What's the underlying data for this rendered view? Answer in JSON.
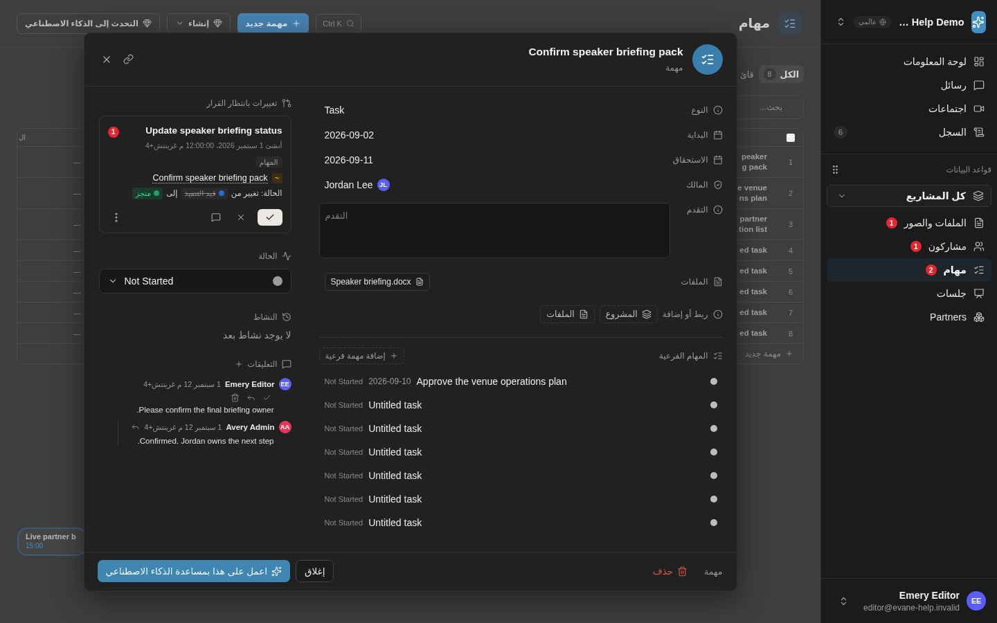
{
  "sidebar": {
    "workspace": {
      "name": "Help Demo …",
      "scope": "عالمي"
    },
    "nav": [
      {
        "label": "لوحة المعلومات",
        "selected": false
      },
      {
        "label": "رسائل",
        "selected": false
      },
      {
        "label": "اجتماعات",
        "selected": false
      },
      {
        "label": "السجل",
        "count": "6",
        "selected": false
      }
    ],
    "section_title": "قواعد البيانات",
    "project_select": "كل المشاريع",
    "databases": [
      {
        "label": "الملفات والصور",
        "badge": "1",
        "selected": false
      },
      {
        "label": "مشاركون",
        "badge": "1",
        "selected": false
      },
      {
        "label": "مهام",
        "badge": "2",
        "selected": true
      },
      {
        "label": "جلسات",
        "selected": false
      },
      {
        "label": "Partners",
        "selected": false
      }
    ],
    "user": {
      "initials": "EE",
      "name": "Emery Editor",
      "email": "editor@evane-help.invalid"
    }
  },
  "page": {
    "title": "مهام",
    "search_shortcut": "Ctrl K",
    "new_button": "مهمة جديد",
    "create_button": "إنشاء",
    "ai_button": "التحدث إلى الذكاء الاصطناعي",
    "tabs": [
      {
        "label": "الكل",
        "count": "8",
        "selected": true
      },
      {
        "label": "قائ",
        "selected": false
      }
    ],
    "search": {
      "placeholder": "بحث..."
    },
    "table": {
      "header_checkbox": {
        "checked": false
      },
      "header_fragment": "ال",
      "rows": [
        {
          "number": "1",
          "title_lines": [
            "peaker",
            "g pack"
          ],
          "fragment": "—"
        },
        {
          "number": "2",
          "title_lines": [
            "e venue",
            "ns plan"
          ],
          "fragment": "—"
        },
        {
          "number": "3",
          "title_lines": [
            "partner",
            "tion list"
          ],
          "fragment": "—"
        },
        {
          "number": "4",
          "title_lines": [
            "ed task"
          ],
          "fragment": "—"
        },
        {
          "number": "5",
          "title_lines": [
            "ed task"
          ],
          "fragment": "—"
        },
        {
          "number": "6",
          "title_lines": [
            "ed task"
          ],
          "fragment": "—"
        },
        {
          "number": "7",
          "title_lines": [
            "ed task"
          ],
          "fragment": "—"
        },
        {
          "number": "8",
          "title_lines": [
            "ed task"
          ],
          "fragment": "—"
        }
      ],
      "add_row": "مهمة جديد"
    },
    "event_card": {
      "title": "Live partner b",
      "time": "15:00"
    }
  },
  "dialog": {
    "title": "Confirm speaker briefing pack",
    "subtitle": "مهمة",
    "fields": [
      {
        "kind": "text",
        "label": "النوع",
        "value": "Task"
      },
      {
        "kind": "date",
        "label": "البداية",
        "value": "2026-09-02"
      },
      {
        "kind": "date",
        "label": "الاستحقاق",
        "value": "2026-09-11"
      },
      {
        "kind": "person",
        "label": "المالك",
        "value": "Jordan Lee",
        "initials": "JL"
      },
      {
        "kind": "textarea",
        "label": "التقدم",
        "placeholder": "التقدم"
      },
      {
        "kind": "files",
        "label": "الملفات",
        "files": [
          "Speaker briefing.docx"
        ]
      },
      {
        "kind": "links",
        "label": "ربط أو إضافة",
        "options": [
          "المشروع",
          "الملفات"
        ]
      }
    ],
    "subtasks": {
      "title": "المهام الفرعية",
      "add_button": "إضافة مهمة فرعية",
      "items": [
        {
          "status": "Not Started",
          "date": "2026-09-10",
          "title": "Approve the venue operations plan"
        },
        {
          "status": "Not Started",
          "title": "Untitled task"
        },
        {
          "status": "Not Started",
          "title": "Untitled task"
        },
        {
          "status": "Not Started",
          "title": "Untitled task"
        },
        {
          "status": "Not Started",
          "title": "Untitled task"
        },
        {
          "status": "Not Started",
          "title": "Untitled task"
        },
        {
          "status": "Not Started",
          "title": "Untitled task"
        }
      ]
    },
    "pending": {
      "title": "تغييرات بانتظار القرار",
      "changes": [
        {
          "badge": "1",
          "title": "Update speaker briefing status",
          "created": "أنشئ 1 سبتمبر 2026، 12:00:00 م غرينتش+4",
          "tag": "المهام",
          "marker": "~",
          "link": "Confirm speaker briefing pack",
          "change_label": "الحالة: تغيير من",
          "from": {
            "label": "قيد التنفيذ",
            "color": "#1e6fd9"
          },
          "to_word": "إلى",
          "to": {
            "label": "منجز",
            "color": "#22a06b"
          }
        }
      ]
    },
    "status": {
      "title": "الحالة",
      "value": "Not Started"
    },
    "activity": {
      "title": "النشاط",
      "empty": "لا يوجد نشاط بعد"
    },
    "comments": {
      "title": "التعليقات",
      "items": [
        {
          "author": "Emery Editor",
          "initials": "EE",
          "color": "#5b5ef5",
          "time": "1 سبتمبر 12 م غرينتش+4",
          "text": "Please confirm the final briefing owner.",
          "replies": [
            {
              "author": "Avery Admin",
              "initials": "AA",
              "color": "#f0335a",
              "time": "1 سبتمبر 12 م غرينتش+4",
              "text": "Confirmed. Jordan owns the next step."
            }
          ]
        }
      ]
    },
    "footer": {
      "type_label": "مهمة",
      "delete": "حذف",
      "close": "إغلاق",
      "ai": "اعمل على هذا بمساعدة الذكاء الاصطناعي"
    }
  }
}
